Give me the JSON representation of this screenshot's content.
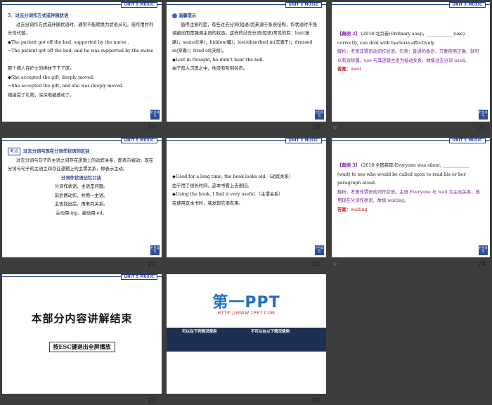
{
  "header_tag": "UNIT 5 MUSIC",
  "corner_label": "栏目导引",
  "slides": [
    {
      "page": "19",
      "lines": [
        "5．过去分词作方式或伴随状语",
        "过去分词作方式或伴随状语时，通常不能转换为状语从句，但可用并列分句代替。",
        "◆The patient got off the bed, supported by the nurse .",
        "→The patient got off the bed, and he was supported by the nurse .",
        "那个病人在护士的搀扶下下了床。",
        "◆She accepted the gift, deeply moved.",
        "→She accepted the gift, and she was deeply moved.",
        "她接受了礼物，深深地被感动了。"
      ]
    },
    {
      "page": "20",
      "lines": [
        "温馨提示",
        "值得注意的是，有些过去分词(短语)因来源于系表结构，作状语时不强调被动而是强调主语的状态。这样的过去分词(短语)常见的有：lost(迷路)；seated(坐)；hidden(藏)；lost/absorbed in(沉湎于)；dressed in(穿着)；tired of(厌烦)。",
        "◆Lost in thought, he didn’t hear the bell.",
        "由于陷入沉思之中，他没有听到铃声。"
      ]
    },
    {
      "page": "21",
      "lines": [
        "【典例 2】",
        "(2018·北京卷)Ordinary soap，____________(use) correctly, can deal with bacteria effectively.",
        "解析：考查非谓语动词作状语。句意：普通的香皂，只要使用正确，就可以有效除菌。use 与其逻辑主语为被动关系，故填过去分词 used。",
        "答案：",
        "used"
      ]
    },
    {
      "page": "22",
      "lines": [
        "考点",
        "过去分词与现在分词作状语的区别",
        "过去分词与句子的主语之间存在逻辑上的动宾关系，即表示被动；现在分词与句子的主语之间存在逻辑上的主谓关系，即表示主动。",
        "分词作状语记忆口诀",
        "分词作状语，主语是问题。",
        "前后两动作，共用一主语。",
        "主语找出后，再来判关系。",
        "主动用-ing，被动用-ed。"
      ]
    },
    {
      "page": "23",
      "lines": [
        "◆Used for a long time, the book looks old.（动宾关系）",
        "由于用了很长时间，这本书看上去很旧。",
        "◆Using the book, I find it very useful.（主谓关系）",
        "在使用这本书时，我发现它很有用。"
      ]
    },
    {
      "page": "24",
      "lines": [
        "【典例 3】",
        "(2018·全国卷Ⅲ)Everyone was silent, ____________ (wait) to see who would be called upon to read his or her paragraph aloud.",
        "解析：考查非谓语动词作状语。主语 Everyone 与 wait 为主动关系，故用现在分词作状语，故填 waiting。",
        "答案：",
        "waiting"
      ]
    },
    {
      "page": "25",
      "lines": [
        "本部分内容讲解结束",
        "按ESC键退出全屏播放"
      ]
    },
    {
      "page": "26",
      "lines": [
        "第一PPT",
        "HTTP://WWW.1PPT.COM",
        "可以在下列情况使用",
        "不可以在以下情况使用"
      ]
    }
  ]
}
